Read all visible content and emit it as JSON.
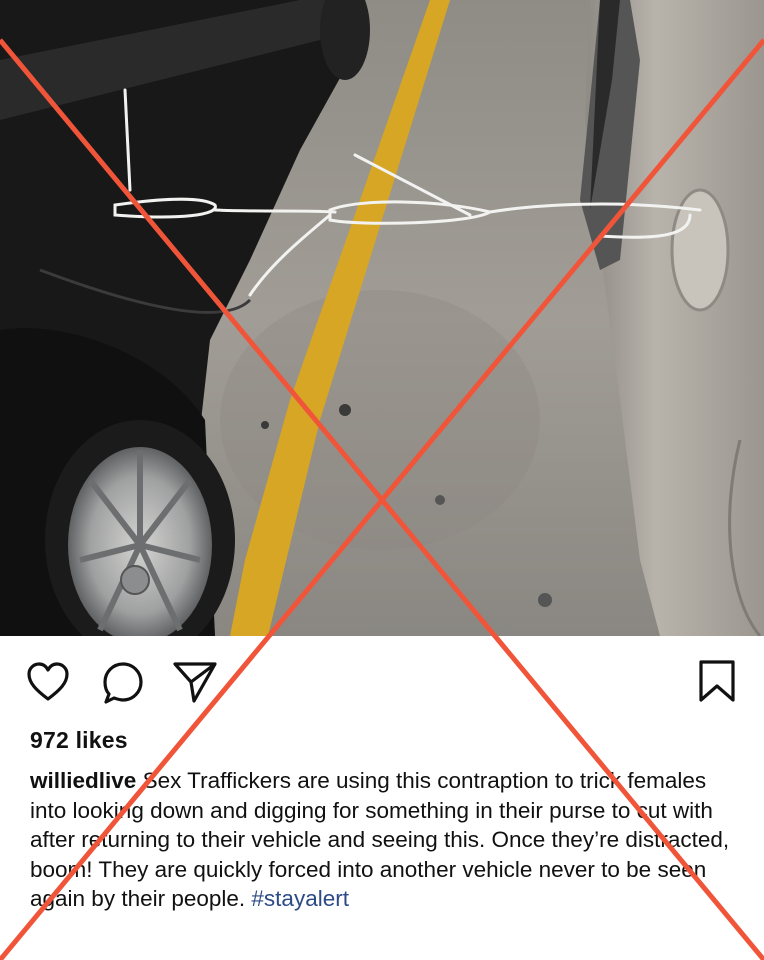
{
  "post": {
    "photo_alt": "cars-in-parking-garage-with-zip-ties",
    "likes_text": "972 likes",
    "username": "williedlive",
    "caption_text": "Sex Traffickers are using this contraption to trick females into looking down and digging for something in their purse to cut with after returning to their vehicle and seeing this. Once they’re distracted, boom! They are quickly forced into another vehicle never to be seen again by their people.",
    "hashtag": "#stayalert"
  },
  "icons": {
    "like": "heart-icon",
    "comment": "comment-icon",
    "share": "share-icon",
    "save": "bookmark-icon"
  },
  "overlay": {
    "cross_color": "#f0553a"
  }
}
